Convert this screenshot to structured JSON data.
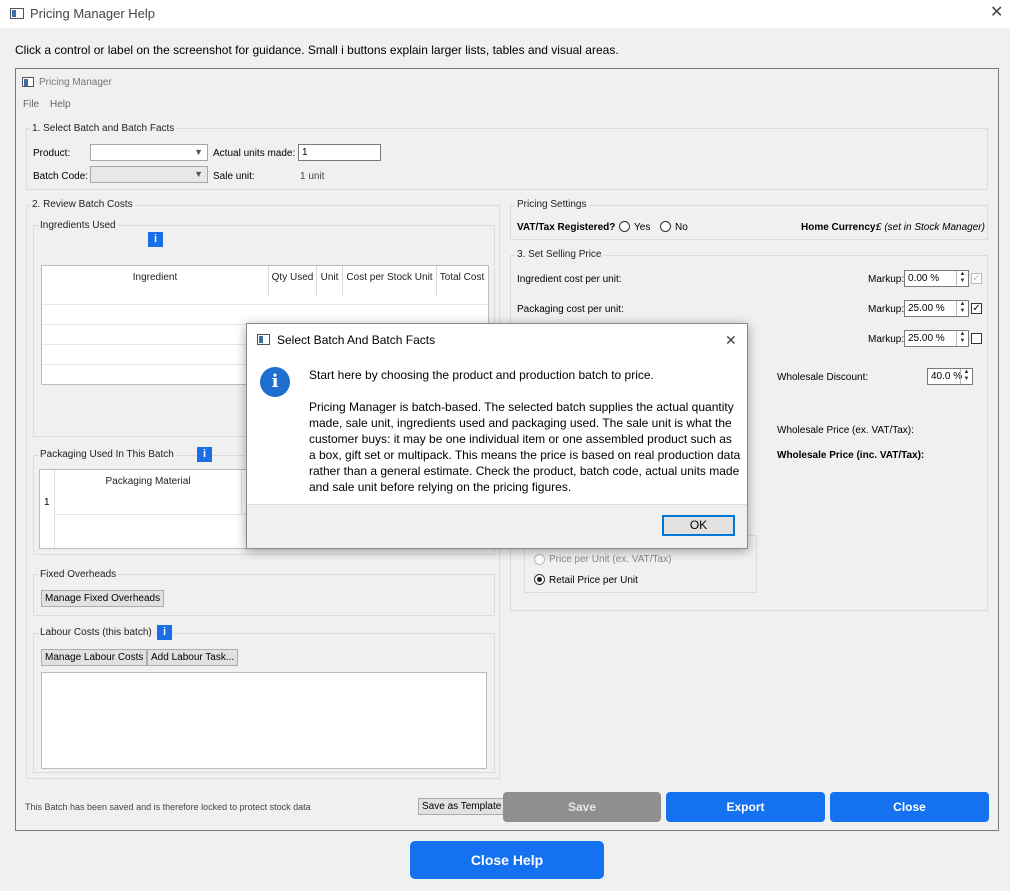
{
  "window": {
    "title": "Pricing Manager Help"
  },
  "instructions": "Click a control or label on the screenshot for guidance. Small i buttons explain larger lists, tables and visual areas.",
  "app": {
    "title": "Pricing Manager",
    "menu": [
      "File",
      "Help"
    ],
    "section1": {
      "title": "1. Select Batch and Batch Facts",
      "product_label": "Product:",
      "product_value": "",
      "actual_units_label": "Actual units made:",
      "actual_units_value": "1",
      "batch_code_label": "Batch Code:",
      "batch_code_value": "",
      "sale_unit_label": "Sale unit:",
      "sale_unit_value": "1 unit"
    },
    "section2": {
      "title": "2. Review Batch Costs",
      "ingredients": {
        "title": "Ingredients Used",
        "columns": [
          "Ingredient",
          "Qty Used",
          "Unit",
          "Cost per Stock Unit",
          "Total Cost"
        ]
      },
      "packaging": {
        "title": "Packaging Used In This Batch",
        "columns": [
          "Packaging Material"
        ],
        "row_number": "1"
      },
      "fixed_overheads": {
        "title": "Fixed Overheads",
        "button": "Manage Fixed Overheads"
      },
      "labour": {
        "title": "Labour Costs (this batch)",
        "manage_button": "Manage Labour Costs",
        "add_button": "Add Labour Task..."
      }
    },
    "pricing_settings": {
      "title": "Pricing Settings",
      "vat_label": "VAT/Tax Registered?",
      "yes": "Yes",
      "no": "No",
      "home_currency_label": "Home Currency:",
      "home_currency_value": "£ (set in Stock Manager)"
    },
    "section3": {
      "title": "3. Set Selling Price",
      "ingredient_cost_label": "Ingredient cost per unit:",
      "packaging_cost_label": "Packaging cost per unit:",
      "markup_label": "Markup:",
      "markup1": "0.00 %",
      "markup2": "25.00 %",
      "markup3": "25.00 %",
      "wholesale_discount_label": "Wholesale Discount:",
      "wholesale_discount_value": "40.0 %",
      "wholesale_ex_label": "Wholesale Price (ex. VAT/Tax):",
      "wholesale_inc_label": "Wholesale Price (inc. VAT/Tax):",
      "price_per_unit_ex": "Price per Unit (ex. VAT/Tax)",
      "retail_price_per_unit": "Retail Price per Unit"
    },
    "footer": {
      "status": "This Batch has been saved and is therefore locked to protect stock data",
      "save_template": "Save as Template",
      "save": "Save",
      "export": "Export",
      "close": "Close"
    }
  },
  "dialog": {
    "title": "Select Batch And Batch Facts",
    "line1": "Start here by choosing the product and production batch to price.",
    "paragraph": [
      "Pricing Manager is batch-based. The selected batch supplies the actual quantity",
      "made, sale unit, ingredients used and packaging used. The sale unit is what the",
      "customer buys: it may be one individual item or one assembled product such as",
      "a box, gift set or multipack. This means the price is based on real production data",
      "rather than a general estimate. Check the product, batch code, actual units made",
      "and sale unit before relying on the pricing figures."
    ],
    "ok": "OK"
  },
  "close_help": "Close Help",
  "colors": {
    "accent": "#1471f0",
    "disabled_button": "#8f8f8f",
    "info_icon": "#1f6fd0"
  }
}
